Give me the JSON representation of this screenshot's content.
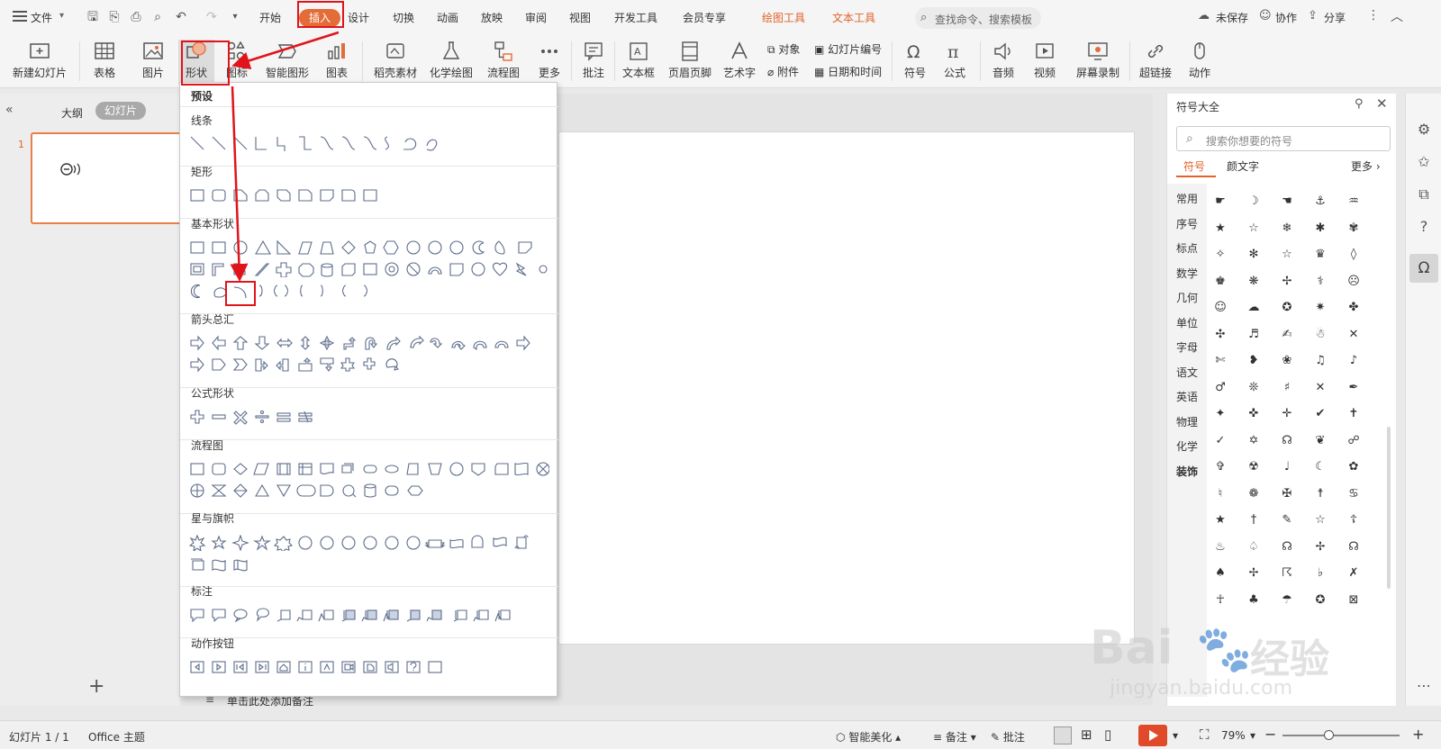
{
  "menubar": {
    "file_label": "文件",
    "tabs": [
      "开始",
      "插入",
      "设计",
      "切换",
      "动画",
      "放映",
      "审阅",
      "视图",
      "开发工具",
      "会员专享"
    ],
    "context_tabs": [
      "绘图工具",
      "文本工具"
    ],
    "search_placeholder": "查找命令、搜索模板",
    "unsaved": "未保存",
    "collab": "协作",
    "share": "分享"
  },
  "ribbon": {
    "new_slide": "新建幻灯片",
    "table": "表格",
    "picture": "图片",
    "shape": "形状",
    "icon": "图标",
    "smartart": "智能图形",
    "chart": "图表",
    "material": "稻壳素材",
    "chem": "化学绘图",
    "flow": "流程图",
    "more": "更多",
    "comment": "批注",
    "textbox": "文本框",
    "header_footer": "页眉页脚",
    "wordart": "艺术字",
    "object": "对象",
    "slide_number": "幻灯片编号",
    "attachment": "附件",
    "datetime": "日期和时间",
    "symbol": "符号",
    "formula": "公式",
    "audio": "音频",
    "video": "视频",
    "screen_record": "屏幕录制",
    "hyperlink": "超链接",
    "action": "动作"
  },
  "leftpanel": {
    "outline_tab": "大纲",
    "slides_tab": "幻灯片",
    "slide_number": "1"
  },
  "notes_placeholder": "单击此处添加备注",
  "shapes_menu": {
    "preset": "预设",
    "sections": [
      "线条",
      "矩形",
      "基本形状",
      "箭头总汇",
      "公式形状",
      "流程图",
      "星与旗帜",
      "标注",
      "动作按钮"
    ]
  },
  "symbols_panel": {
    "title": "符号大全",
    "search_placeholder": "搜索你想要的符号",
    "tab_symbol": "符号",
    "tab_emoji": "颜文字",
    "more": "更多",
    "categories": [
      "常用",
      "序号",
      "标点",
      "数学",
      "几何",
      "单位",
      "字母",
      "语文",
      "英语",
      "物理",
      "化学",
      "装饰"
    ],
    "symbols": [
      "☛",
      "☽",
      "☚",
      "⚓",
      "♒",
      "★",
      "☆",
      "❄",
      "✱",
      "✾",
      "✧",
      "✻",
      "☆",
      "♛",
      "◊",
      "♚",
      "❋",
      "✢",
      "⚕",
      "☹",
      "☺",
      "☁",
      "✪",
      "✷",
      "✤",
      "✣",
      "♬",
      "✍",
      "☃",
      "✕",
      "✄",
      "❥",
      "❀",
      "♫",
      "♪",
      "♂",
      "❊",
      "♯",
      "✕",
      "✒",
      "✦",
      "✜",
      "✛",
      "✔",
      "✝",
      "✓",
      "✡",
      "☊",
      "❦",
      "☍",
      "✞",
      "☢",
      "♩",
      "☾",
      "✿",
      "♮",
      "❁",
      "✠",
      "☨",
      "♋",
      "★",
      "†",
      "✎",
      "☆",
      "☦",
      "♨",
      "♤",
      "☊",
      "✢",
      "☊",
      "♠",
      "✢",
      "☈",
      "♭",
      "✗",
      "☥",
      "♣",
      "☂",
      "✪",
      "⊠"
    ]
  },
  "statusbar": {
    "slide_counter": "幻灯片 1 / 1",
    "theme": "Office 主题",
    "beautify": "智能美化",
    "notes": "备注",
    "comments": "批注",
    "zoom": "79%"
  },
  "watermark": {
    "brand": "Bai",
    "brand_cn": "经验",
    "url": "jingyan.baidu.com"
  },
  "colors": {
    "accent": "#e46c38",
    "annotation_red": "#e0141a"
  }
}
